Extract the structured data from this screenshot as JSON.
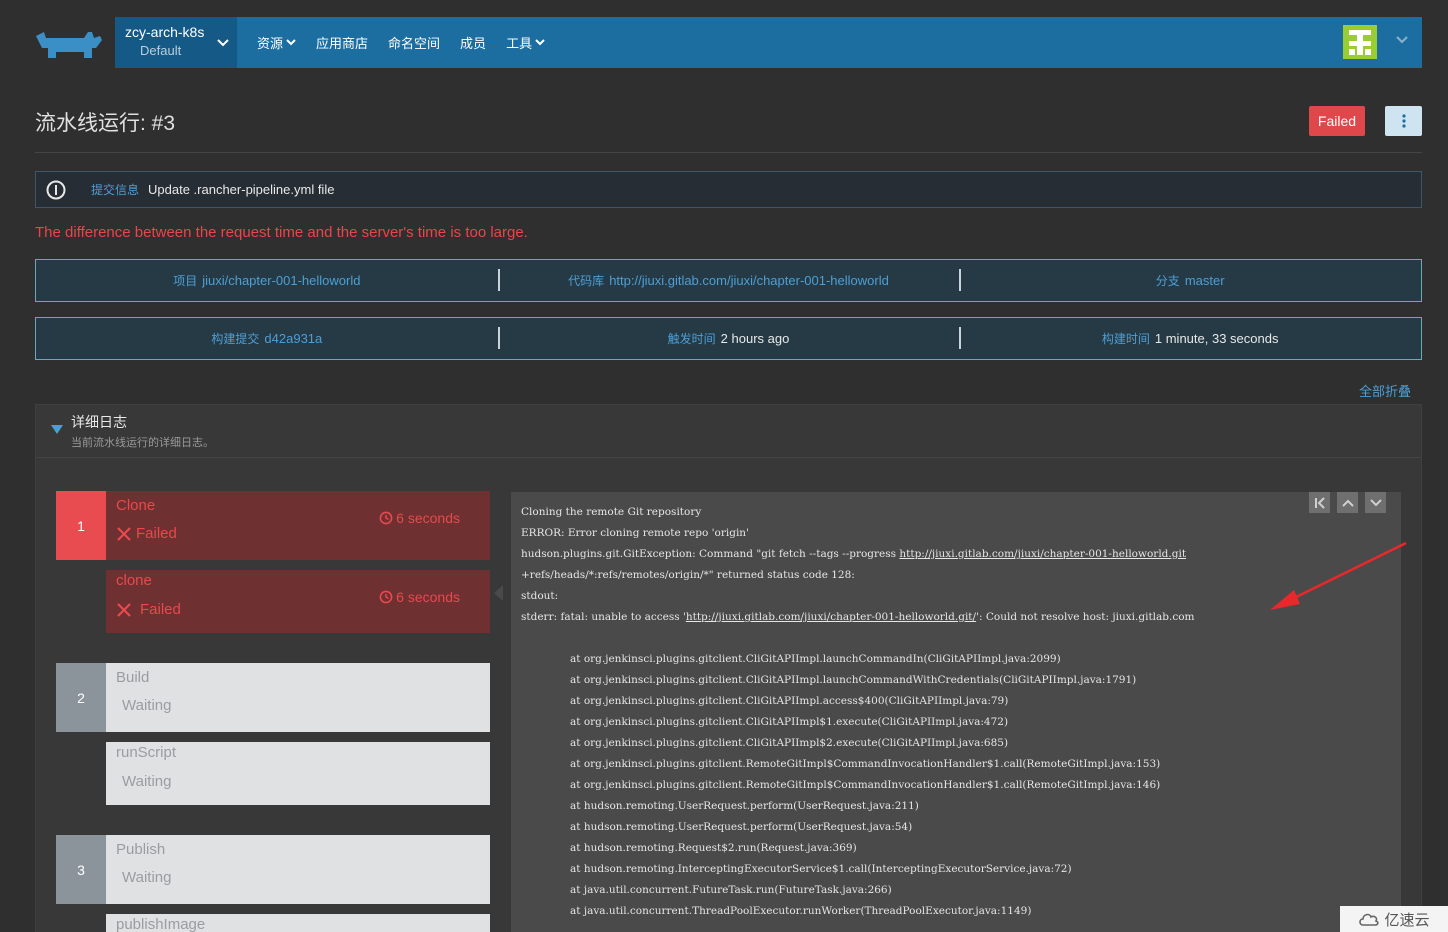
{
  "header": {
    "cluster_name": "zcy-arch-k8s",
    "cluster_project": "Default",
    "nav": [
      {
        "label": "资源",
        "has_dropdown": true
      },
      {
        "label": "应用商店",
        "has_dropdown": false
      },
      {
        "label": "命名空间",
        "has_dropdown": false
      },
      {
        "label": "成员",
        "has_dropdown": false
      },
      {
        "label": "工具",
        "has_dropdown": true
      }
    ]
  },
  "page": {
    "title": "流水线运行: #3",
    "status": "Failed"
  },
  "commit": {
    "label": "提交信息",
    "message": "Update .rancher-pipeline.yml file"
  },
  "error_message": "The difference between the request time and the server's time is too large.",
  "info_row1": {
    "project_label": "项目",
    "project": "jiuxi/chapter-001-helloworld",
    "repo_label": "代码库",
    "repo": "http://jiuxi.gitlab.com/jiuxi/chapter-001-helloworld",
    "branch_label": "分支",
    "branch": "master"
  },
  "info_row2": {
    "commit_label": "构建提交",
    "commit": "d42a931a",
    "trigger_label": "触发时间",
    "trigger": "2 hours ago",
    "duration_label": "构建时间",
    "duration": "1 minute, 33 seconds"
  },
  "collapse_all": "全部折叠",
  "log_section": {
    "title": "详细日志",
    "subtitle": "当前流水线运行的详细日志。"
  },
  "stages": [
    {
      "num": "1",
      "name": "Clone",
      "status": "Failed",
      "time": "6 seconds",
      "steps": [
        {
          "name": "clone",
          "status": "Failed",
          "time": "6 seconds"
        }
      ]
    },
    {
      "num": "2",
      "name": "Build",
      "status": "Waiting",
      "steps": [
        {
          "name": "runScript",
          "status": "Waiting"
        }
      ]
    },
    {
      "num": "3",
      "name": "Publish",
      "status": "Waiting",
      "steps": [
        {
          "name": "publishImage",
          "status": ""
        }
      ]
    }
  ],
  "log_lines": [
    {
      "text": "Cloning the remote Git repository"
    },
    {
      "text": "ERROR: Error cloning remote repo 'origin'"
    },
    {
      "pre": "hudson.plugins.git.GitException: Command \"git fetch --tags --progress ",
      "link": "http://jiuxi.gitlab.com/jiuxi/chapter-001-helloworld.git"
    },
    {
      "text": "+refs/heads/*:refs/remotes/origin/*\" returned status code 128:"
    },
    {
      "text": "stdout:"
    },
    {
      "pre": "stderr: fatal: unable to access '",
      "link": "http://jiuxi.gitlab.com/jiuxi/chapter-001-helloworld.git/",
      "post": "': Could not resolve host: jiuxi.gitlab.com"
    },
    {
      "text": ""
    },
    {
      "text": "at org.jenkinsci.plugins.gitclient.CliGitAPIImpl.launchCommandIn(CliGitAPIImpl.java:2099)",
      "indent": true
    },
    {
      "text": "at org.jenkinsci.plugins.gitclient.CliGitAPIImpl.launchCommandWithCredentials(CliGitAPIImpl.java:1791)",
      "indent": true
    },
    {
      "text": "at org.jenkinsci.plugins.gitclient.CliGitAPIImpl.access$400(CliGitAPIImpl.java:79)",
      "indent": true
    },
    {
      "text": "at org.jenkinsci.plugins.gitclient.CliGitAPIImpl$1.execute(CliGitAPIImpl.java:472)",
      "indent": true
    },
    {
      "text": "at org.jenkinsci.plugins.gitclient.CliGitAPIImpl$2.execute(CliGitAPIImpl.java:685)",
      "indent": true
    },
    {
      "text": "at org.jenkinsci.plugins.gitclient.RemoteGitImpl$CommandInvocationHandler$1.call(RemoteGitImpl.java:153)",
      "indent": true
    },
    {
      "text": "at org.jenkinsci.plugins.gitclient.RemoteGitImpl$CommandInvocationHandler$1.call(RemoteGitImpl.java:146)",
      "indent": true
    },
    {
      "text": "at hudson.remoting.UserRequest.perform(UserRequest.java:211)",
      "indent": true
    },
    {
      "text": "at hudson.remoting.UserRequest.perform(UserRequest.java:54)",
      "indent": true
    },
    {
      "text": "at hudson.remoting.Request$2.run(Request.java:369)",
      "indent": true
    },
    {
      "text": "at hudson.remoting.InterceptingExecutorService$1.call(InterceptingExecutorService.java:72)",
      "indent": true
    },
    {
      "text": "at java.util.concurrent.FutureTask.run(FutureTask.java:266)",
      "indent": true
    },
    {
      "text": "at java.util.concurrent.ThreadPoolExecutor.runWorker(ThreadPoolExecutor.java:1149)",
      "indent": true
    }
  ],
  "watermark": "亿速云",
  "colors": {
    "nav_bg": "#1c6ea0",
    "failed": "#e94c50",
    "link": "#4c9fd6",
    "annotation_arrow": "#e8282b"
  }
}
